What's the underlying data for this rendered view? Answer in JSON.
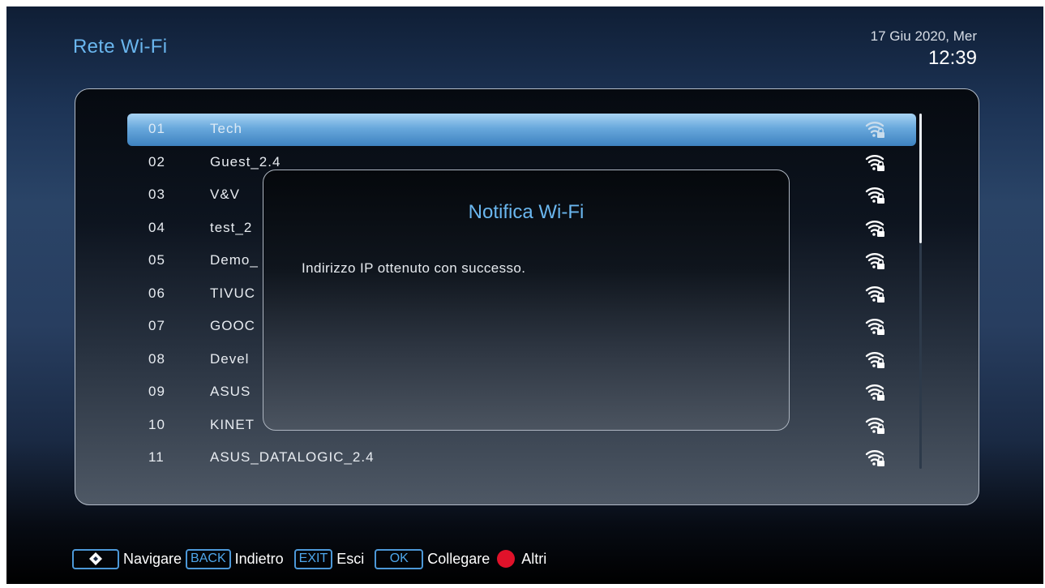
{
  "header": {
    "title": "Rete Wi-Fi",
    "date": "17 Giu 2020, Mer",
    "time": "12:39"
  },
  "networks": [
    {
      "num": "01",
      "ssid": "Tech",
      "selected": true,
      "icon": "wifi-lock-icon"
    },
    {
      "num": "02",
      "ssid": "Guest_2.4",
      "icon": "wifi-lock-icon"
    },
    {
      "num": "03",
      "ssid": "V&V",
      "icon": "wifi-lock-icon"
    },
    {
      "num": "04",
      "ssid": "test_2",
      "icon": "wifi-lock-icon"
    },
    {
      "num": "05",
      "ssid": "Demo_",
      "icon": "wifi-lock-icon"
    },
    {
      "num": "06",
      "ssid": "TIVUC",
      "icon": "wifi-lock-icon"
    },
    {
      "num": "07",
      "ssid": "GOOC",
      "icon": "wifi-lock-icon"
    },
    {
      "num": "08",
      "ssid": "Devel",
      "icon": "wifi-lock-icon"
    },
    {
      "num": "09",
      "ssid": "ASUS",
      "icon": "wifi-lock-icon"
    },
    {
      "num": "10",
      "ssid": "KINET",
      "icon": "wifi-lock-icon"
    },
    {
      "num": "11",
      "ssid": "ASUS_DATALOGIC_2.4",
      "icon": "wifi-lock-icon"
    }
  ],
  "dialog": {
    "title": "Notifica Wi-Fi",
    "message": "Indirizzo IP ottenuto con successo."
  },
  "help": {
    "navigate_label": "Navigare",
    "back_key": "BACK",
    "back_label": "Indietro",
    "exit_key": "EXIT",
    "exit_label": "Esci",
    "ok_key": "OK",
    "ok_label": "Collegare",
    "more_label": "Altri"
  },
  "colors": {
    "accent": "#6ab6ee",
    "selection": "#5a9fd8",
    "red_button": "#e0122a"
  }
}
